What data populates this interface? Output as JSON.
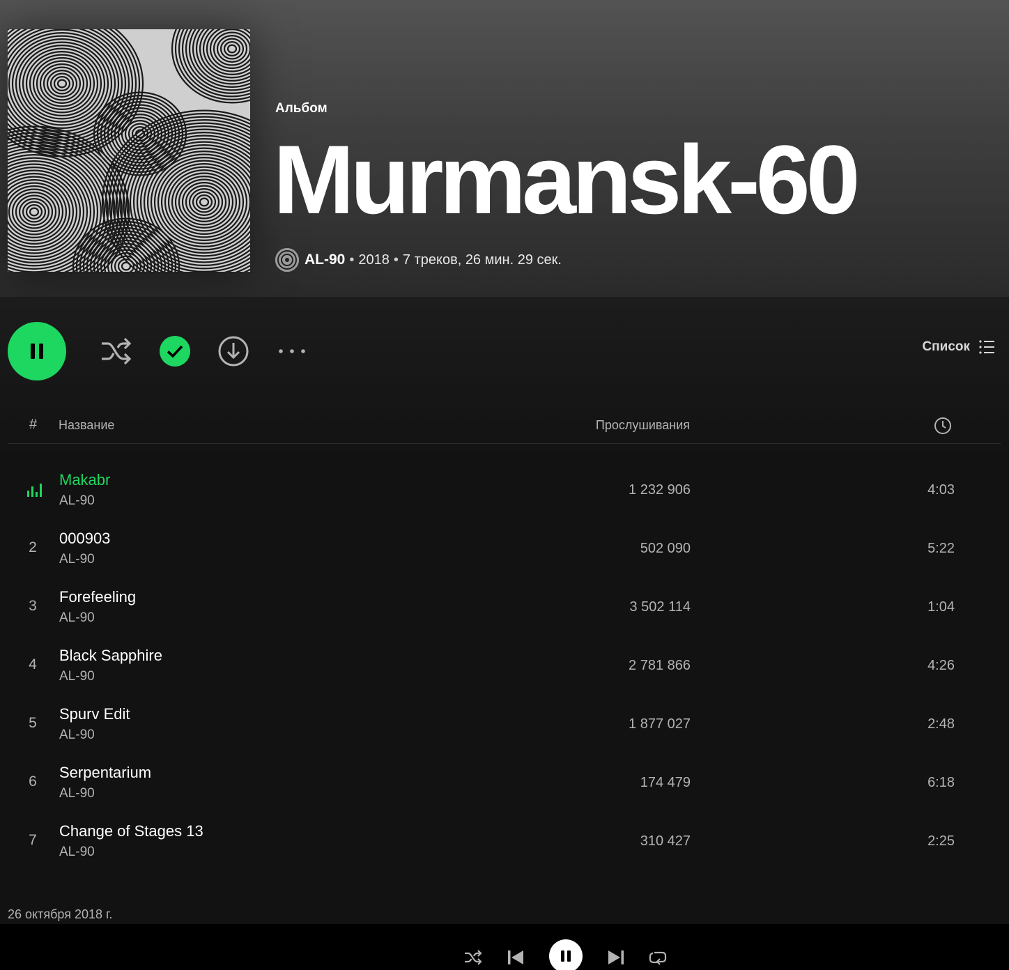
{
  "album": {
    "type_label": "Альбом",
    "title": "Murmansk-60",
    "artist": "AL-90",
    "year": "2018",
    "summary": "7 треков, 26 мин. 29 сек.",
    "release_date": "26 октября 2018 г."
  },
  "controls": {
    "view_label": "Список"
  },
  "table": {
    "col_num": "#",
    "col_title": "Название",
    "col_plays": "Прослушивания"
  },
  "tracks": [
    {
      "num": "1",
      "title": "Makabr",
      "artist": "AL-90",
      "plays": "1 232 906",
      "duration": "4:03",
      "playing": true
    },
    {
      "num": "2",
      "title": "000903",
      "artist": "AL-90",
      "plays": "502 090",
      "duration": "5:22"
    },
    {
      "num": "3",
      "title": "Forefeeling",
      "artist": "AL-90",
      "plays": "3 502 114",
      "duration": "1:04"
    },
    {
      "num": "4",
      "title": "Black Sapphire",
      "artist": "AL-90",
      "plays": "2 781 866",
      "duration": "4:26"
    },
    {
      "num": "5",
      "title": "Spurv Edit",
      "artist": "AL-90",
      "plays": "1 877 027",
      "duration": "2:48"
    },
    {
      "num": "6",
      "title": "Serpentarium",
      "artist": "AL-90",
      "plays": "174 479",
      "duration": "6:18"
    },
    {
      "num": "7",
      "title": "Change of Stages 13",
      "artist": "AL-90",
      "plays": "310 427",
      "duration": "2:25"
    }
  ],
  "colors": {
    "accent": "#1ed760",
    "background": "#121212",
    "header_top": "#535353",
    "text_secondary": "#b3b3b3"
  },
  "icons": {
    "main_play": "pause-icon",
    "shuffle": "shuffle-icon",
    "saved": "check-circle-icon",
    "download": "download-icon",
    "more": "more-icon",
    "list": "list-icon",
    "duration": "clock-icon",
    "now_playing": "equalizer-icon"
  }
}
